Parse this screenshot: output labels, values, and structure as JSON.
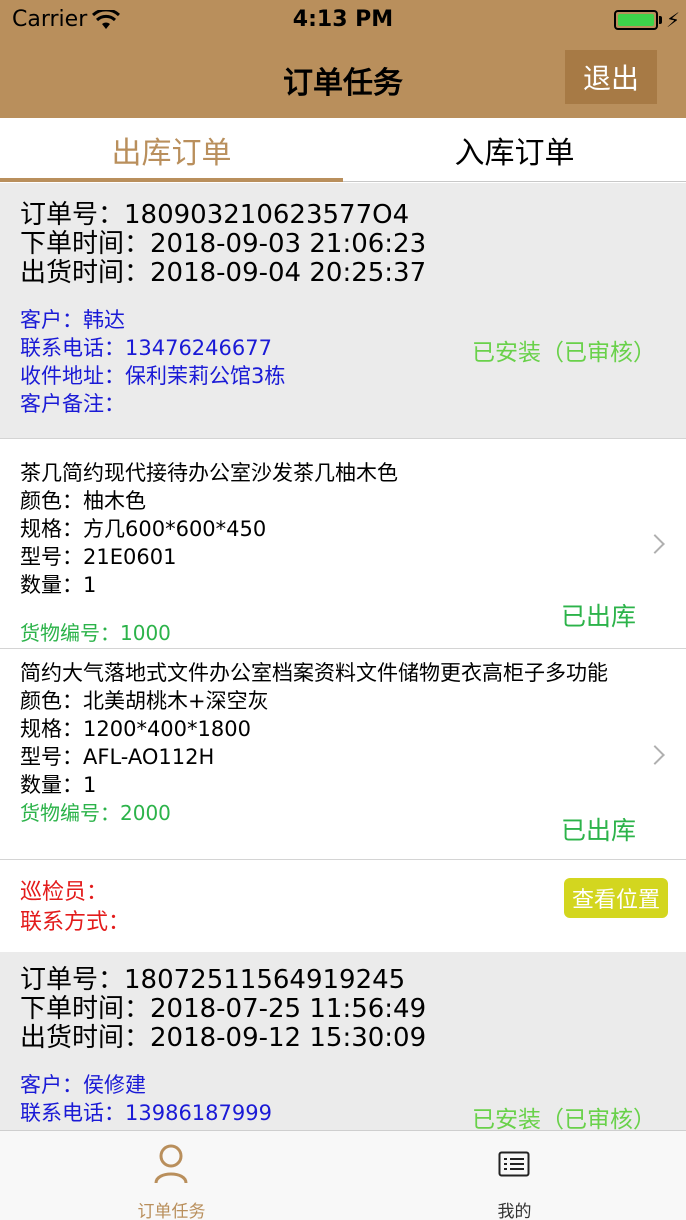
{
  "status": {
    "carrier": "Carrier",
    "time": "4:13 PM",
    "charging": "⚡"
  },
  "nav": {
    "title": "订单任务",
    "logout_label": "退出"
  },
  "tabs": {
    "outbound": "出库订单",
    "inbound": "入库订单"
  },
  "orders": [
    {
      "order_no": "订单号：180903210623577O4",
      "order_time": "下单时间：2018-09-03 21:06:23",
      "ship_time": "出货时间：2018-09-04 20:25:37",
      "customer": "客户：韩达",
      "phone": "联系电话：13476246677",
      "address": "收件地址：保利茉莉公馆3栋",
      "remark": "客户备注：",
      "status": "已安装（已审核）",
      "items": [
        {
          "name": "茶几简约现代接待办公室沙发茶几柚木色",
          "color": "颜色：柚木色",
          "spec": "规格：方几600*600*450",
          "model": "型号：21E0601",
          "qty": "数量：1",
          "code": "货物编号：1000",
          "out_status": "已出库"
        },
        {
          "name": "简约大气落地式文件办公室档案资料文件储物更衣高柜子多功能",
          "color": "颜色：北美胡桃木+深空灰",
          "spec": "规格：1200*400*1800",
          "model": "型号：AFL-AO112H",
          "qty": "数量：1",
          "code": "货物编号：2000",
          "out_status": "已出库"
        }
      ],
      "inspector": "巡检员：",
      "contact": "联系方式：",
      "locate_label": "查看位置"
    },
    {
      "order_no": "订单号：18072511564919245",
      "order_time": "下单时间：2018-07-25 11:56:49",
      "ship_time": "出货时间：2018-09-12 15:30:09",
      "customer": "客户：侯修建",
      "phone": "联系电话：13986187999",
      "status": "已安装（已审核）"
    }
  ],
  "tabbar": {
    "orders_label": "订单任务",
    "mine_label": "我的"
  },
  "colors": {
    "brand": "#b98f5c",
    "status_green": "#69d14a",
    "link_blue": "#1a1ad6",
    "alert_red": "#e31b1b",
    "locate_yellow": "#d3d61f"
  }
}
